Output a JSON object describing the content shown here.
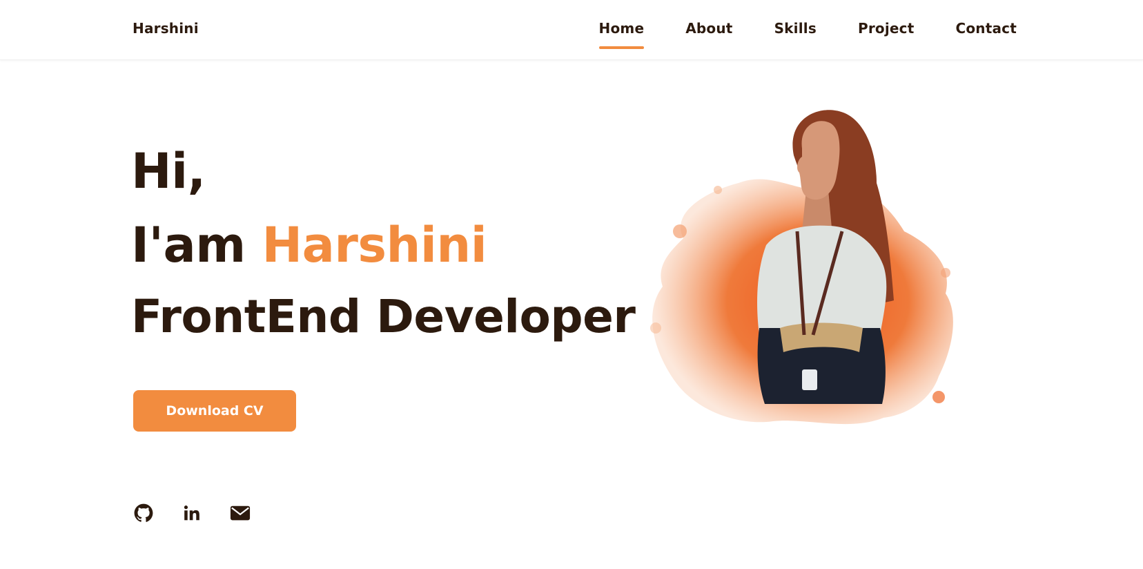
{
  "header": {
    "logo": "Harshini",
    "nav": [
      {
        "label": "Home",
        "active": true
      },
      {
        "label": "About",
        "active": false
      },
      {
        "label": "Skills",
        "active": false
      },
      {
        "label": "Project",
        "active": false
      },
      {
        "label": "Contact",
        "active": false
      }
    ]
  },
  "hero": {
    "greeting": "Hi,",
    "intro_prefix": "I'am",
    "name": "Harshini",
    "role": "FrontEnd Developer",
    "cv_button": "Download CV"
  },
  "social": [
    {
      "icon": "github-icon"
    },
    {
      "icon": "linkedin-icon"
    },
    {
      "icon": "email-icon"
    }
  ],
  "colors": {
    "accent": "#f28c3f",
    "text": "#2c1a0e",
    "background": "#ffffff"
  }
}
